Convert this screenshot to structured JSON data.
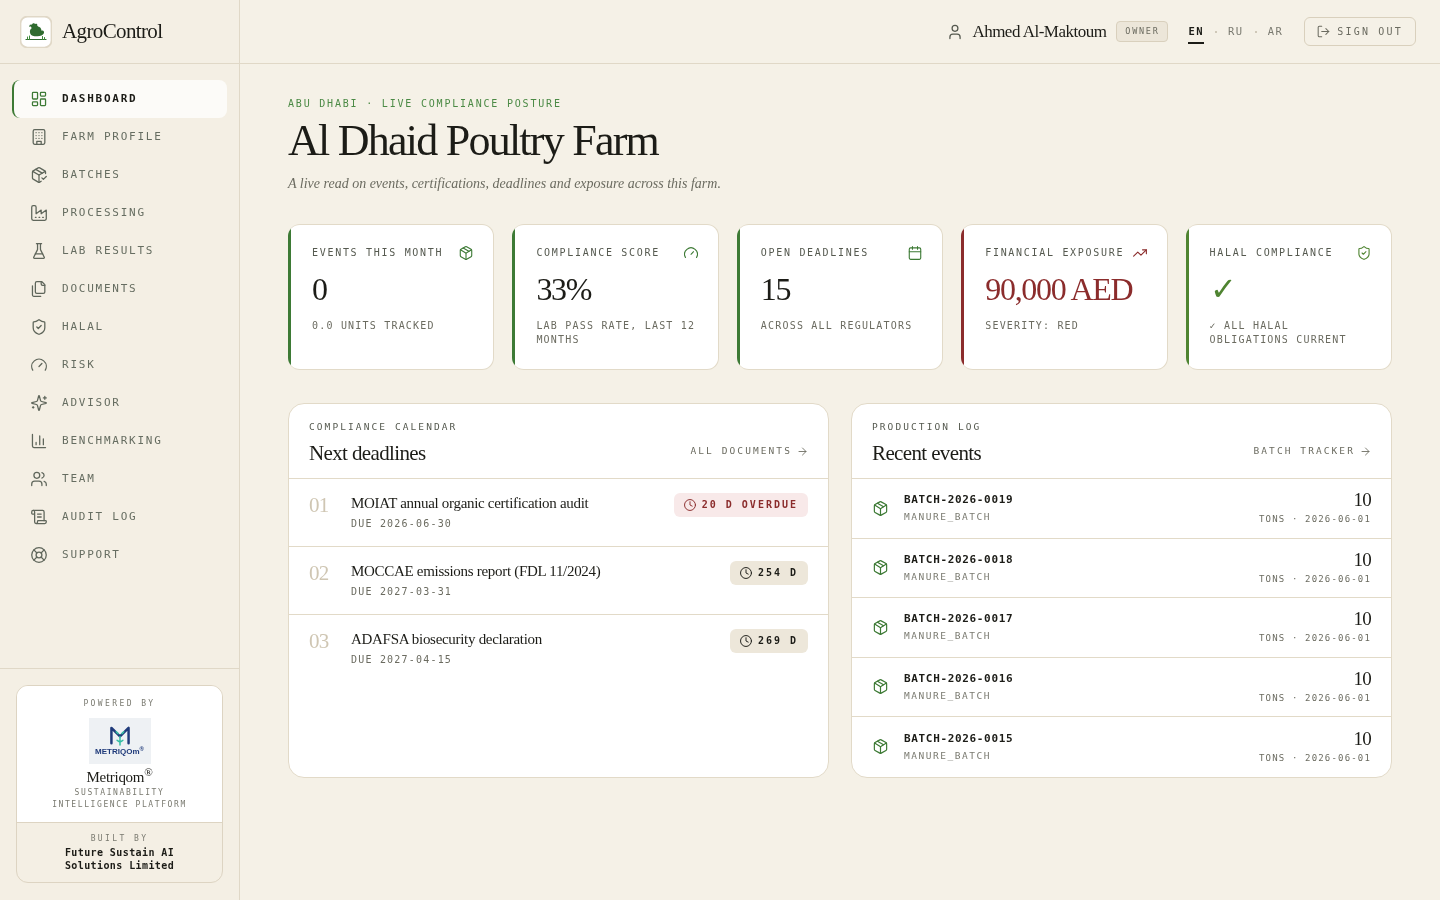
{
  "brand": {
    "name": "AgroControl"
  },
  "sidebar": {
    "items": [
      {
        "label": "DASHBOARD",
        "selected": true
      },
      {
        "label": "FARM PROFILE",
        "selected": false
      },
      {
        "label": "BATCHES",
        "selected": false
      },
      {
        "label": "PROCESSING",
        "selected": false
      },
      {
        "label": "LAB RESULTS",
        "selected": false
      },
      {
        "label": "DOCUMENTS",
        "selected": false
      },
      {
        "label": "HALAL",
        "selected": false
      },
      {
        "label": "RISK",
        "selected": false
      },
      {
        "label": "ADVISOR",
        "selected": false
      },
      {
        "label": "BENCHMARKING",
        "selected": false
      },
      {
        "label": "TEAM",
        "selected": false
      },
      {
        "label": "AUDIT LOG",
        "selected": false
      },
      {
        "label": "SUPPORT",
        "selected": false
      }
    ],
    "footer": {
      "powered_by": "POWERED BY",
      "logo_wordmark": "METRIQOm$^{®}$",
      "product": "Metriqom$^{®}$",
      "tagline": "SUSTAINABILITY INTELLIGENCE PLATFORM",
      "built_by": "BUILT BY",
      "builder": "Future Sustain AI Solutions Limited"
    }
  },
  "header": {
    "user": "Ahmed Al-Maktoum",
    "role": "OWNER",
    "languages": [
      {
        "label": "EN",
        "selected": true
      },
      {
        "label": "RU",
        "selected": false
      },
      {
        "label": "AR",
        "selected": false
      }
    ],
    "sign_out": "SIGN OUT"
  },
  "page": {
    "eyebrow": "ABU DHABI · LIVE COMPLIANCE POSTURE",
    "title": "Al Dhaid Poultry Farm",
    "subtitle": "A live read on events, certifications, deadlines and exposure across this farm."
  },
  "kpis": [
    {
      "label": "EVENTS THIS MONTH",
      "value": "0",
      "note": "0.0 UNITS TRACKED",
      "kind": "metric",
      "color": "#3d7a35"
    },
    {
      "label": "COMPLIANCE SCORE",
      "value": "33%",
      "note": "LAB PASS RATE, LAST 12 MONTHS",
      "kind": "metric",
      "color": "#3d7a35"
    },
    {
      "label": "OPEN DEADLINES",
      "value": "15",
      "note": "ACROSS ALL REGULATORS",
      "kind": "metric",
      "color": "#3d7a35"
    },
    {
      "label": "FINANCIAL EXPOSURE",
      "value": "90,000 AED",
      "note": "SEVERITY: RED",
      "kind": "highlight",
      "color": "#8b2c2c"
    },
    {
      "label": "HALAL COMPLIANCE",
      "value": "✓",
      "note": "✓ ALL HALAL OBLIGATIONS CURRENT",
      "kind": "highlight",
      "color": "#4f8431"
    }
  ],
  "deadlines": {
    "eyebrow": "COMPLIANCE CALENDAR",
    "title": "Next deadlines",
    "link": "ALL DOCUMENTS",
    "items": [
      {
        "number": "01",
        "title": "MOIAT annual organic certification audit",
        "due": "DUE 2026-06-30",
        "badge": "20 D OVERDUE",
        "overdue": true
      },
      {
        "number": "02",
        "title": "MOCCAE emissions report (FDL 11/2024)",
        "due": "DUE 2027-03-31",
        "badge": "254 D",
        "overdue": false
      },
      {
        "number": "03",
        "title": "ADAFSA biosecurity declaration",
        "due": "DUE 2027-04-15",
        "badge": "269 D",
        "overdue": false
      }
    ]
  },
  "events": {
    "eyebrow": "PRODUCTION LOG",
    "title": "Recent events",
    "link": "BATCH TRACKER",
    "items": [
      {
        "id": "BATCH-2026-0019",
        "type": "MANURE_BATCH",
        "quantity": "10",
        "meta": "TONS · 2026-06-01"
      },
      {
        "id": "BATCH-2026-0018",
        "type": "MANURE_BATCH",
        "quantity": "10",
        "meta": "TONS · 2026-06-01"
      },
      {
        "id": "BATCH-2026-0017",
        "type": "MANURE_BATCH",
        "quantity": "10",
        "meta": "TONS · 2026-06-01"
      },
      {
        "id": "BATCH-2026-0016",
        "type": "MANURE_BATCH",
        "quantity": "10",
        "meta": "TONS · 2026-06-01"
      },
      {
        "id": "BATCH-2026-0015",
        "type": "MANURE_BATCH",
        "quantity": "10",
        "meta": "TONS · 2026-06-01"
      }
    ]
  }
}
